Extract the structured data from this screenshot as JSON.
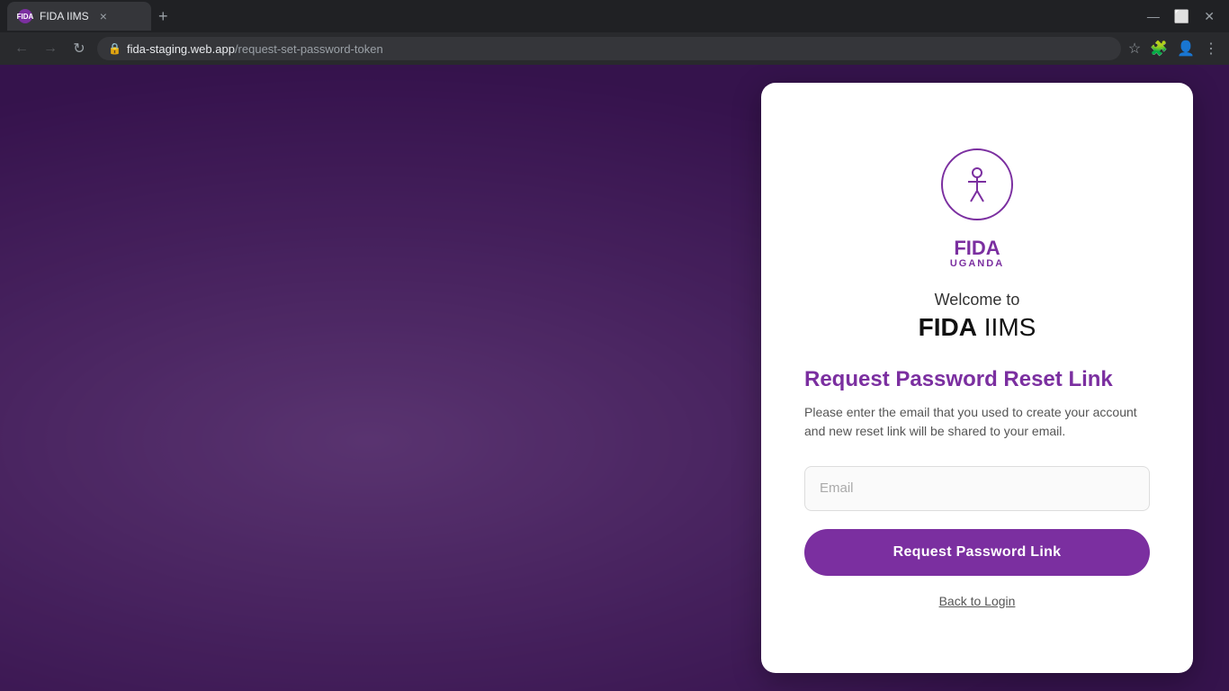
{
  "browser": {
    "tab": {
      "favicon_label": "F",
      "title": "FIDA IIMS",
      "close_label": "×"
    },
    "new_tab_label": "+",
    "window_controls": {
      "minimize": "—",
      "maximize": "⬜",
      "close": "✕"
    },
    "nav": {
      "back_label": "←",
      "forward_label": "→",
      "reload_label": "↻"
    },
    "address": {
      "domain": "fida-staging.web.app",
      "path": "/request-set-password-token"
    }
  },
  "logo": {
    "figure_icon": "🧍",
    "fida_label": "FIDA",
    "uganda_label": "UGANDA"
  },
  "card": {
    "welcome_label": "Welcome to",
    "app_name_bold": "FIDA",
    "app_name_regular": " IIMS",
    "section_title": "Request Password Reset Link",
    "section_description": "Please enter the email that you used to create your account and new reset link will be shared to your email.",
    "email_placeholder": "Email",
    "submit_button_label": "Request Password Link",
    "back_link_label": "Back to Login"
  }
}
